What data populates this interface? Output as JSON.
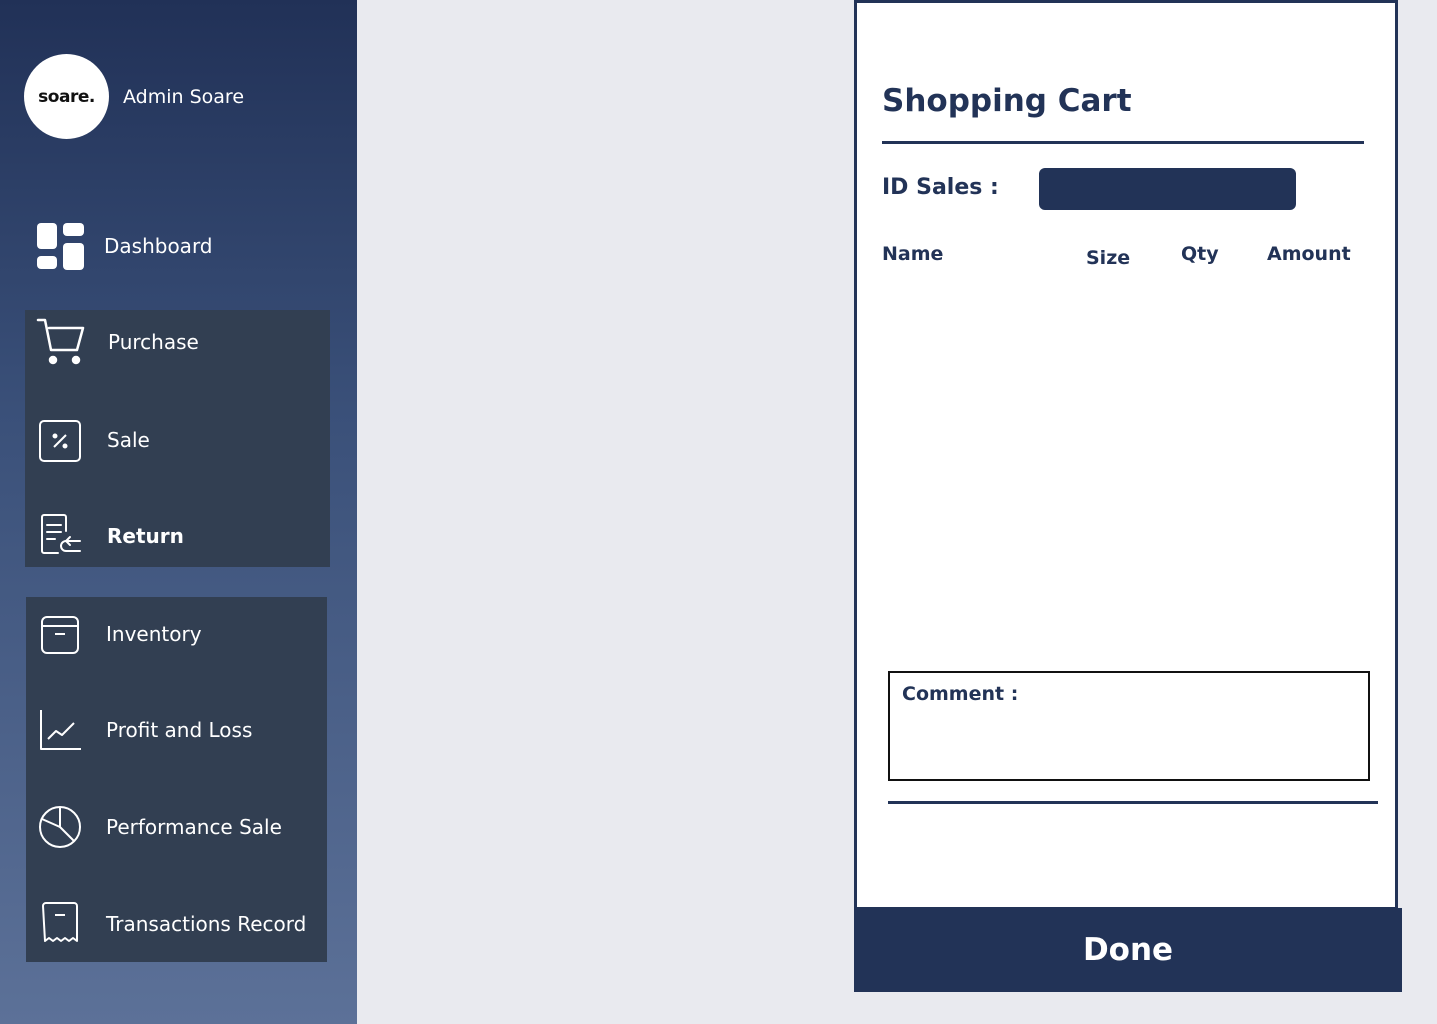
{
  "profile": {
    "logo_text": "soare.",
    "name": "Admin Soare"
  },
  "nav": {
    "dashboard": "Dashboard",
    "purchase": "Purchase",
    "sale": "Sale",
    "return": "Return",
    "inventory": "Inventory",
    "profit_loss": "Profit and Loss",
    "performance_sale": "Performance Sale",
    "transactions_record": "Transactions Record"
  },
  "cart": {
    "title": "Shopping Cart",
    "id_sales_label": "ID Sales :",
    "id_sales_value": "",
    "columns": {
      "name": "Name",
      "size": "Size",
      "qty": "Qty",
      "amount": "Amount"
    },
    "comment_label": "Comment :",
    "comment_value": "",
    "done_label": "Done"
  },
  "colors": {
    "primary": "#223357",
    "sidebar_group": "#323f52",
    "background": "#e9eaef"
  }
}
